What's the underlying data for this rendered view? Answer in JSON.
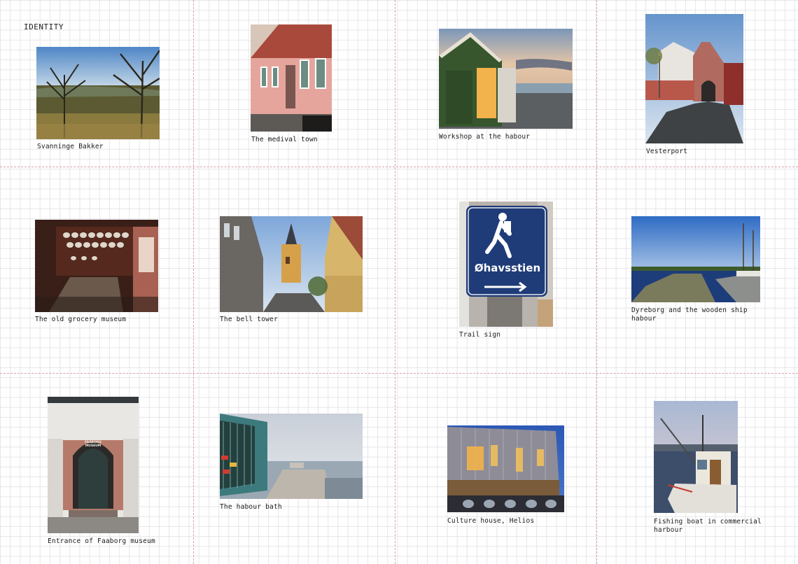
{
  "page": {
    "title": "IDENTITY"
  },
  "photos": [
    {
      "caption": "Svanninge Bakker"
    },
    {
      "caption": "The medival town"
    },
    {
      "caption": "Workshop at the habour"
    },
    {
      "caption": "Vesterport"
    },
    {
      "caption": "The old grocery museum"
    },
    {
      "caption": "The bell tower"
    },
    {
      "caption": "Trail sign",
      "sign_text": "Øhavsstien"
    },
    {
      "caption": "Dyreborg and the wooden ship habour"
    },
    {
      "caption": "Entrance of Faaborg museum",
      "plaque_text": "FAABORG MUSEUM"
    },
    {
      "caption": "The habour bath"
    },
    {
      "caption": "Culture house, Helios"
    },
    {
      "caption": "Fishing boat in commercial harbour"
    }
  ]
}
